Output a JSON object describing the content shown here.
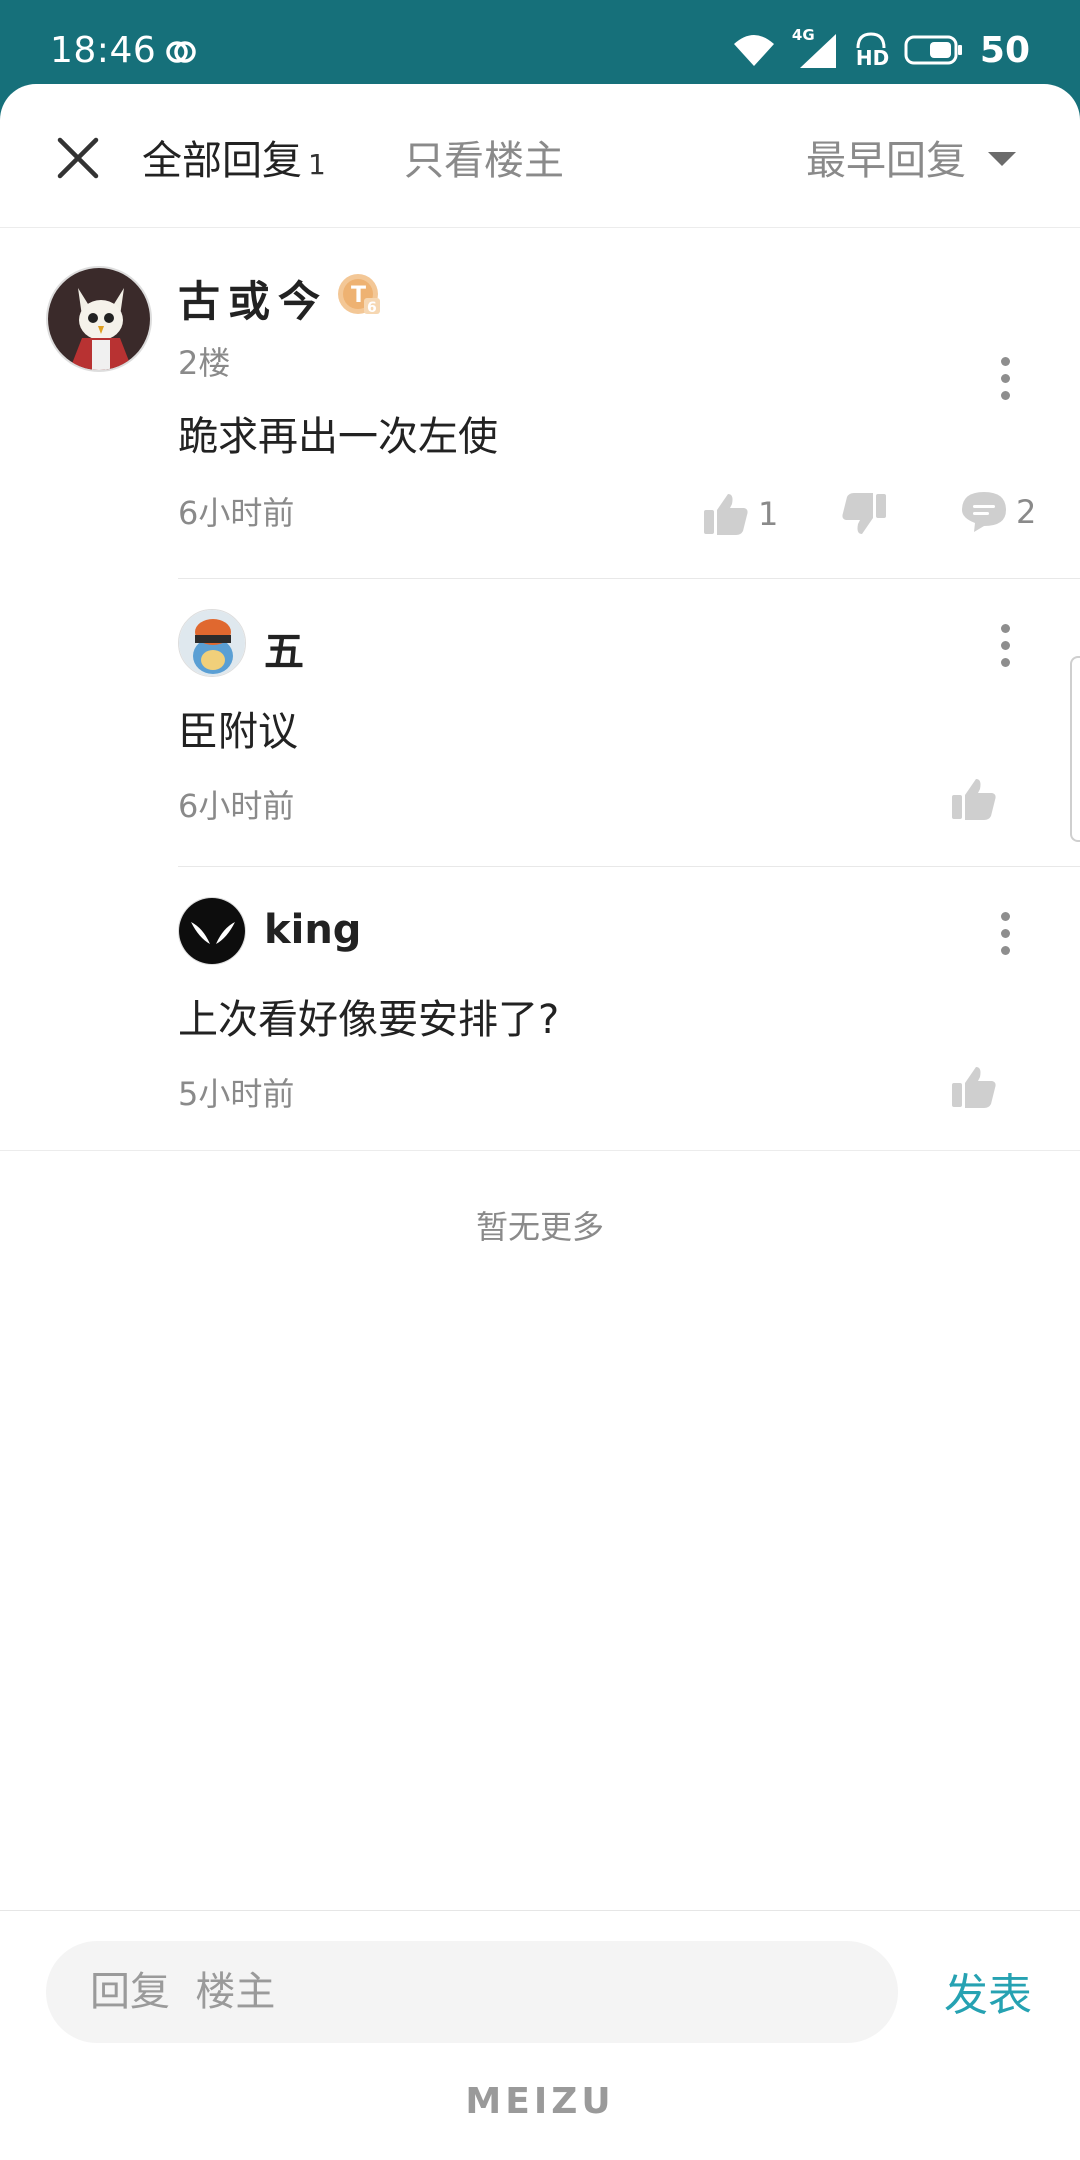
{
  "status_bar": {
    "time": "18:46",
    "network": "4G",
    "hd": "HD",
    "battery": "50"
  },
  "header": {
    "tab_all_label": "全部回复",
    "tab_all_count": "1",
    "tab_owner_label": "只看楼主",
    "sort_label": "最早回复"
  },
  "main_comment": {
    "username": "古或今",
    "level_badge": "T6",
    "floor": "2楼",
    "text": "跪求再出一次左使",
    "time": "6小时前",
    "like_count": "1",
    "reply_count": "2"
  },
  "replies": [
    {
      "username": "五",
      "text": "臣附议",
      "time": "6小时前"
    },
    {
      "username": "king",
      "text": "上次看好像要安排了?",
      "time": "5小时前"
    }
  ],
  "footer": {
    "no_more_text": "暂无更多",
    "input_placeholder": "回复  楼主",
    "publish_label": "发表",
    "brand": "MEIZU"
  },
  "colors": {
    "status_bar_bg": "#16707a",
    "accent": "#26a2b2",
    "secondary_text": "#8a8a8a"
  }
}
